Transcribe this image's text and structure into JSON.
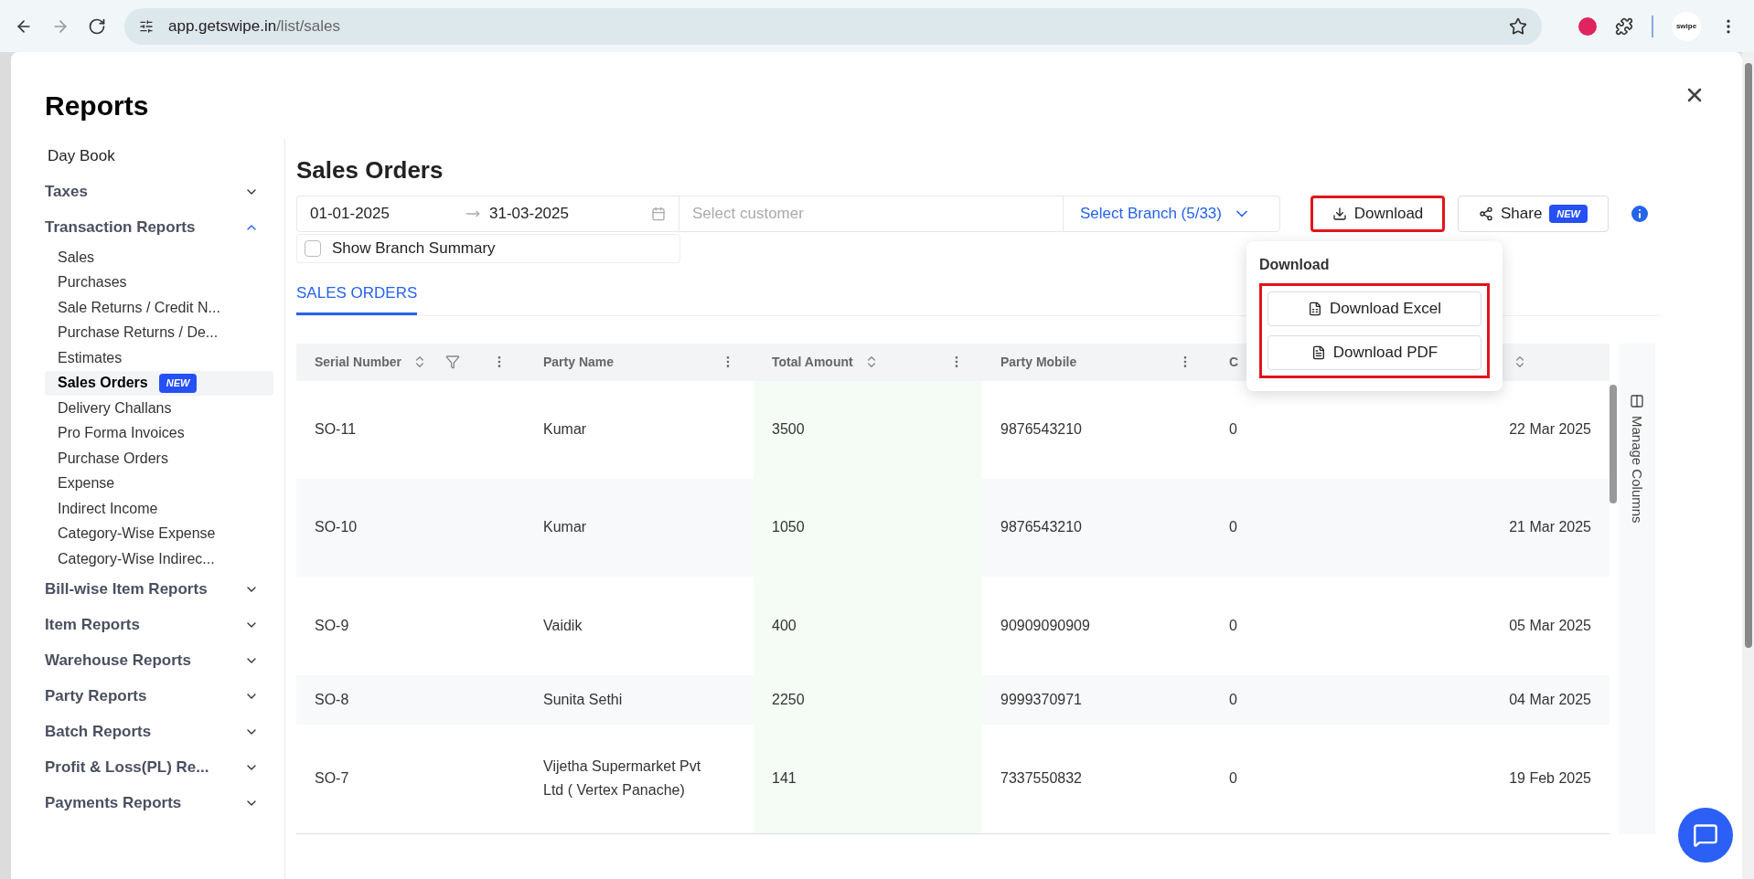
{
  "browser": {
    "url_host": "app.getswipe.in",
    "url_path": "/list/sales",
    "profile_label": "swipe"
  },
  "title": "Reports",
  "sidebar": {
    "items": [
      {
        "label": "Day Book",
        "kind": "link"
      },
      {
        "label": "Taxes",
        "kind": "group",
        "expanded": false
      },
      {
        "label": "Transaction Reports",
        "kind": "group",
        "expanded": true,
        "children": [
          {
            "label": "Sales",
            "selected": false
          },
          {
            "label": "Purchases",
            "selected": false
          },
          {
            "label": "Sale Returns / Credit N...",
            "selected": false
          },
          {
            "label": "Purchase Returns / De...",
            "selected": false
          },
          {
            "label": "Estimates",
            "selected": false
          },
          {
            "label": "Sales Orders",
            "selected": true,
            "badge": "NEW"
          },
          {
            "label": "Delivery Challans",
            "selected": false
          },
          {
            "label": "Pro Forma Invoices",
            "selected": false
          },
          {
            "label": "Purchase Orders",
            "selected": false
          },
          {
            "label": "Expense",
            "selected": false
          },
          {
            "label": "Indirect Income",
            "selected": false
          },
          {
            "label": "Category-Wise Expense",
            "selected": false
          },
          {
            "label": "Category-Wise Indirec...",
            "selected": false
          }
        ]
      },
      {
        "label": "Bill-wise Item Reports",
        "kind": "group",
        "expanded": false
      },
      {
        "label": "Item Reports",
        "kind": "group",
        "expanded": false
      },
      {
        "label": "Warehouse Reports",
        "kind": "group",
        "expanded": false
      },
      {
        "label": "Party Reports",
        "kind": "group",
        "expanded": false
      },
      {
        "label": "Batch Reports",
        "kind": "group",
        "expanded": false
      },
      {
        "label": "Profit & Loss(PL) Re...",
        "kind": "group",
        "expanded": false
      },
      {
        "label": "Payments Reports",
        "kind": "group",
        "expanded": false
      }
    ]
  },
  "heading": "Sales Orders",
  "filters": {
    "date_from": "01-01-2025",
    "date_to": "31-03-2025",
    "customer_placeholder": "Select customer",
    "branch": "Select Branch (5/33)",
    "branch_summary": {
      "label": "Show Branch Summary",
      "checked": false
    }
  },
  "actions": {
    "download": {
      "label": "Download",
      "highlighted": true
    },
    "share": {
      "label": "Share",
      "badge": "NEW"
    }
  },
  "download_menu": {
    "title": "Download",
    "highlighted": true,
    "items": [
      {
        "label": "Download Excel",
        "kind": "excel"
      },
      {
        "label": "Download PDF",
        "kind": "pdf"
      }
    ]
  },
  "tabs": [
    {
      "label": "SALES ORDERS",
      "selected": true
    }
  ],
  "table": {
    "columns": [
      {
        "label": "Serial Number",
        "sortable": true,
        "filter": true,
        "menu": true
      },
      {
        "label": "Party Name",
        "sortable": false,
        "filter": false,
        "menu": true
      },
      {
        "label": "Total Amount",
        "sortable": true,
        "filter": false,
        "menu": true
      },
      {
        "label": "Party Mobile",
        "sortable": false,
        "filter": false,
        "menu": true
      },
      {
        "label": "C"
      },
      {
        "sortable": true
      }
    ],
    "rows": [
      [
        "SO-11",
        "Kumar",
        "3500",
        "9876543210",
        "0",
        "22 Mar 2025"
      ],
      [
        "SO-10",
        "Kumar",
        "1050",
        "9876543210",
        "0",
        "21 Mar 2025"
      ],
      [
        "SO-9",
        "Vaidik",
        "400",
        "90909090909",
        "0",
        "05 Mar 2025"
      ],
      [
        "SO-8",
        "Sunita Sethi",
        "2250",
        "9999370971",
        "0",
        "04 Mar 2025"
      ],
      [
        "SO-7",
        "Vijetha Supermarket Pvt Ltd ( Vertex Panache)",
        "141",
        "7337550832",
        "0",
        "19 Feb 2025"
      ]
    ],
    "manage_columns": "Manage Columns"
  }
}
